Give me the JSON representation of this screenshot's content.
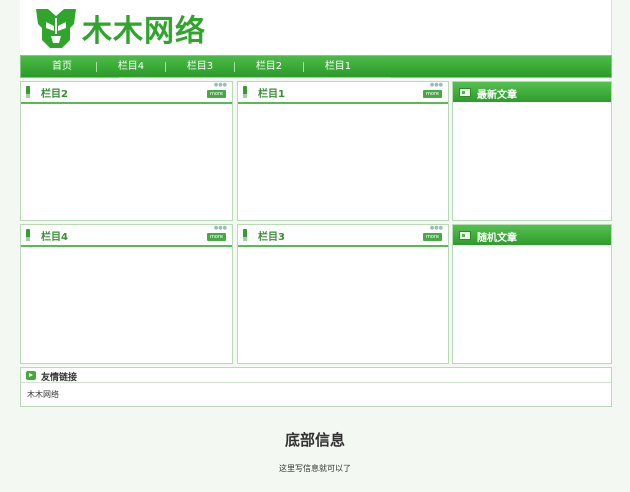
{
  "site": {
    "name": "木木网络"
  },
  "nav": {
    "items": [
      "首页",
      "栏目4",
      "栏目3",
      "栏目2",
      "栏目1"
    ]
  },
  "panels": [
    {
      "title": "栏目2",
      "more": "more"
    },
    {
      "title": "栏目1",
      "more": "more"
    },
    {
      "title": "栏目4",
      "more": "more"
    },
    {
      "title": "栏目3",
      "more": "more"
    }
  ],
  "sidebar": {
    "latest_title": "最新文章",
    "random_title": "随机文章"
  },
  "links": {
    "title": "友情链接",
    "items": [
      "木木网络"
    ]
  },
  "footer": {
    "title": "底部信息",
    "text": "这里写信息就可以了"
  },
  "colors": {
    "accent": "#2fa52b",
    "nav_bg": "#3aa836",
    "border": "#b9d9b7"
  }
}
